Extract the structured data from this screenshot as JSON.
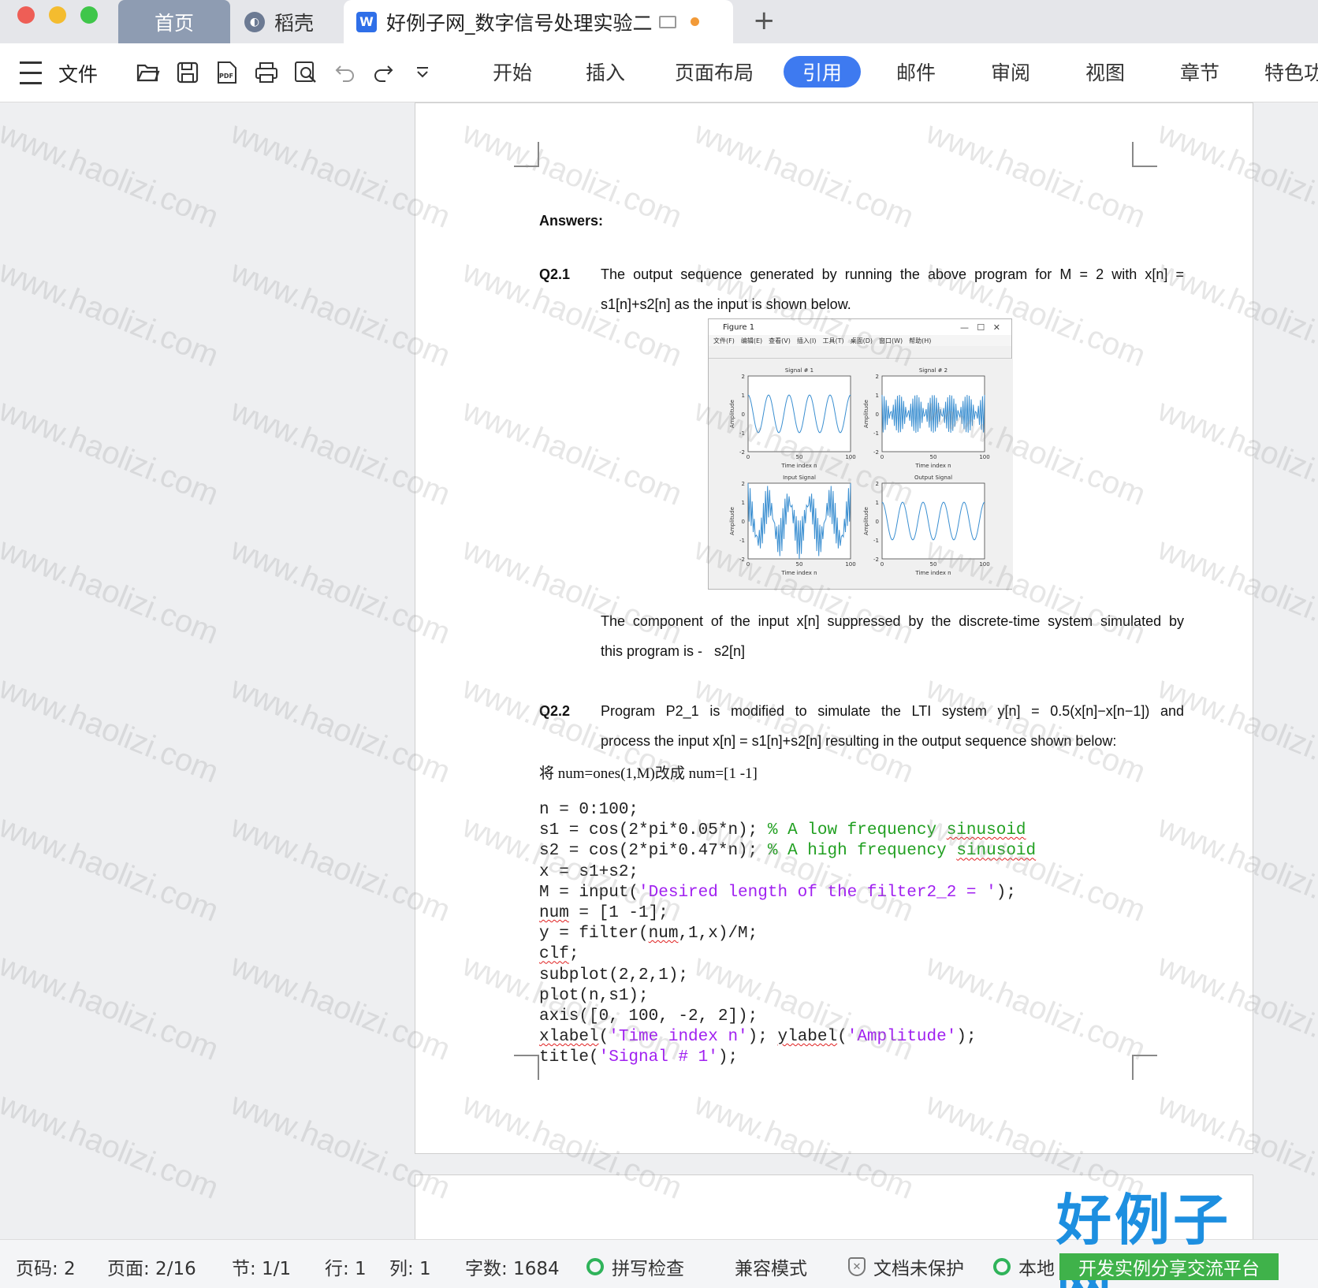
{
  "window": {
    "tabs": [
      {
        "label": "首页"
      },
      {
        "label": "稻壳"
      },
      {
        "label": "好例子网_数字信号处理实验二"
      }
    ],
    "new_tab_symbol": "+",
    "colors": {
      "accent": "#3e7af0",
      "active_tab": "#ffffff",
      "home_tab": "#8e9cb2"
    }
  },
  "toolbar": {
    "file_label": "文件",
    "icons": [
      "menu-icon",
      "open-folder-icon",
      "save-icon",
      "pdf-icon",
      "print-icon",
      "print-preview-icon",
      "undo-icon",
      "redo-icon",
      "more-dropdown-icon"
    ],
    "ribbon_tabs": [
      "开始",
      "插入",
      "页面布局",
      "引用",
      "邮件",
      "审阅",
      "视图",
      "章节",
      "特色功"
    ],
    "active_ribbon_tab": "引用"
  },
  "document": {
    "answers_heading": "Answers:",
    "q21": {
      "label": "Q2.1",
      "para_line1": "The output sequence generated by running the above program for M = 2 with x[n] =",
      "para_line2": "s1[n]+s2[n] as the input is shown below.",
      "after_line1": "The component of the input x[n] suppressed by the discrete-time system simulated by",
      "after_line2": "this program is -   s2[n]"
    },
    "figure": {
      "window_title": "Figure 1",
      "menu": [
        "文件(F)",
        "编辑(E)",
        "查看(V)",
        "插入(I)",
        "工具(T)",
        "桌面(D)",
        "窗口(W)",
        "帮助(H)"
      ],
      "subplots": [
        {
          "title": "Signal # 1",
          "xlabel": "Time index n",
          "ylabel": "Amplitude"
        },
        {
          "title": "Signal # 2",
          "xlabel": "Time index n",
          "ylabel": "Amplitude"
        },
        {
          "title": "Input Signal",
          "xlabel": "Time index n",
          "ylabel": "Amplitude"
        },
        {
          "title": "Output Signal",
          "xlabel": "Time index n",
          "ylabel": "Amplitude"
        }
      ],
      "x_ticks": [
        "0",
        "50",
        "100"
      ],
      "y_ticks": [
        "2",
        "1",
        "0",
        "-1",
        "-2"
      ]
    },
    "q22": {
      "label": "Q2.2",
      "para_line1": "Program P2_1 is modified to simulate the LTI system y[n] = 0.5(x[n]−x[n−1]) and",
      "para_line2": "process the input x[n] = s1[n]+s2[n] resulting in the output sequence shown below:"
    },
    "code_intro": "将 num=ones(1,M)改成 num=[1 -1]",
    "code_lines": [
      "n = 0:100;",
      "s1 = cos(2*pi*0.05*n); % A low frequency sinusoid",
      "s2 = cos(2*pi*0.47*n); % A high frequency sinusoid",
      "x = s1+s2;",
      "M = input('Desired length of the filter2_2 = ');",
      "num = [1 -1];",
      "y = filter(num,1,x)/M;",
      "clf;",
      "subplot(2,2,1);",
      "plot(n,s1);",
      "axis([0, 100, -2, 2]);",
      "xlabel('Time index n'); ylabel('Amplitude');",
      "title('Signal # 1');"
    ]
  },
  "statusbar": {
    "page_code": "页码: 2",
    "page_count": "页面: 2/16",
    "section": "节: 1/1",
    "row": "行: 1",
    "column": "列: 1",
    "word_count": "字数: 1684",
    "spell_check": "拼写检查",
    "compat_mode": "兼容模式",
    "doc_protect": "文档未保护",
    "local": "本地"
  },
  "watermark": {
    "text": "www.haolizi.com"
  },
  "brand": {
    "main": "好例子网",
    "sub": "开发实例分享交流平台"
  }
}
